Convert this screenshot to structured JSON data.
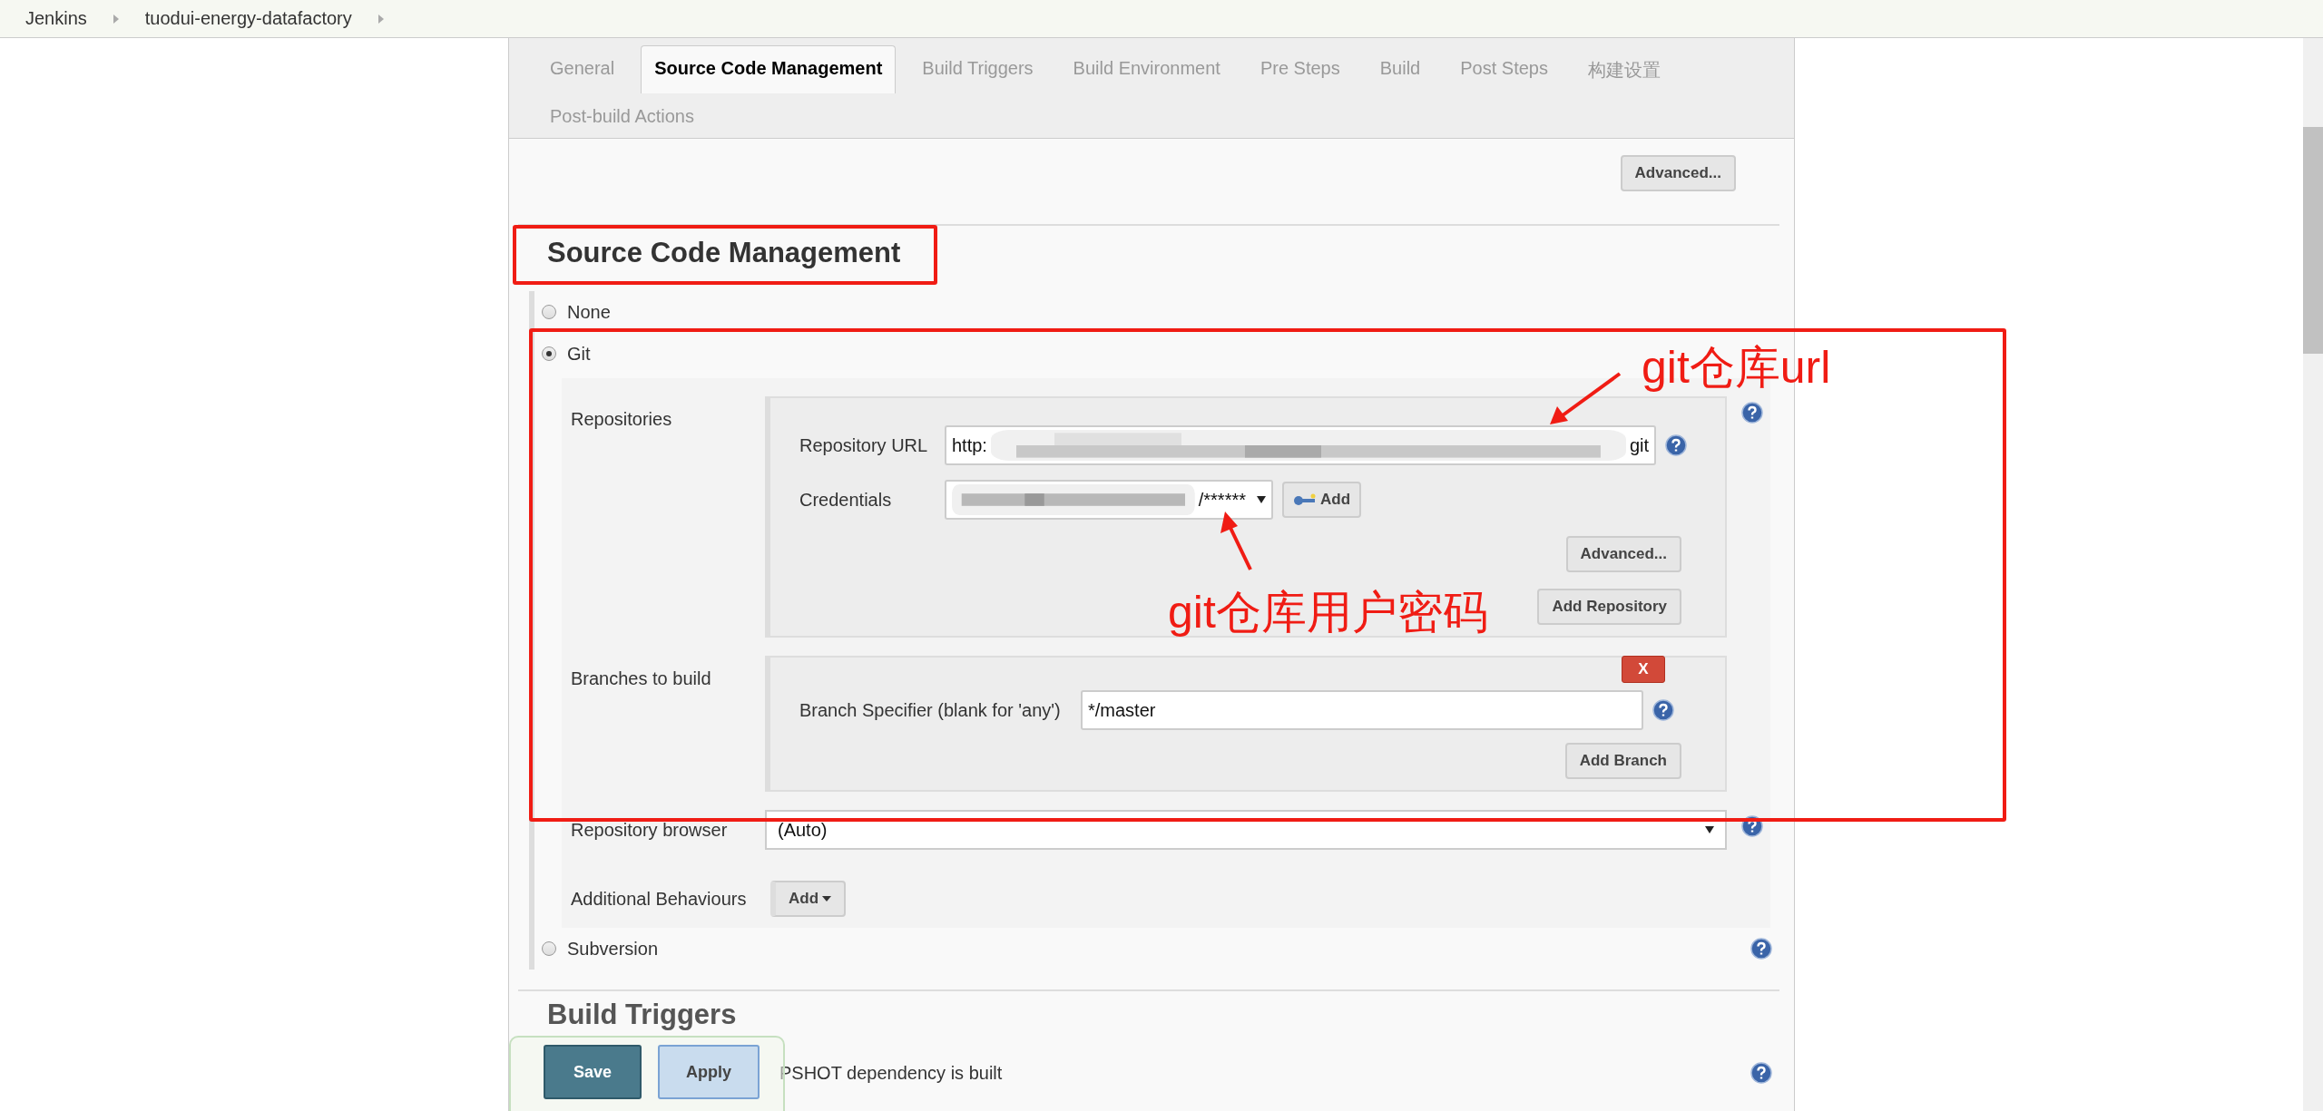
{
  "breadcrumb": [
    "Jenkins",
    "tuodui-energy-datafactory"
  ],
  "tabs": [
    {
      "label": "General",
      "selected": false
    },
    {
      "label": "Source Code Management",
      "selected": true
    },
    {
      "label": "Build Triggers",
      "selected": false
    },
    {
      "label": "Build Environment",
      "selected": false
    },
    {
      "label": "Pre Steps",
      "selected": false
    },
    {
      "label": "Build",
      "selected": false
    },
    {
      "label": "Post Steps",
      "selected": false
    },
    {
      "label": "构建设置",
      "selected": false
    },
    {
      "label": "Post-build Actions",
      "selected": false
    }
  ],
  "advanced_button": "Advanced...",
  "section": {
    "title": "Source Code Management"
  },
  "scm_options": [
    {
      "label": "None",
      "selected": false
    },
    {
      "label": "Git",
      "selected": true
    },
    {
      "label": "Subversion",
      "selected": false
    }
  ],
  "git": {
    "repositories_label": "Repositories",
    "repository_url": {
      "label": "Repository URL",
      "value_start": "http:",
      "value_end": "git"
    },
    "credentials": {
      "label": "Credentials",
      "value": "/******",
      "add_button": "Add"
    },
    "advanced_button": "Advanced...",
    "add_repository_button": "Add Repository",
    "branches_label": "Branches to build",
    "branch_specifier": {
      "label": "Branch Specifier (blank for 'any')",
      "value": "*/master",
      "delete_button": "X"
    },
    "add_branch_button": "Add Branch",
    "repository_browser": {
      "label": "Repository browser",
      "value": "(Auto)"
    },
    "additional_behaviours": {
      "label": "Additional Behaviours",
      "add_button": "Add"
    }
  },
  "next_section": {
    "title": "Build Triggers",
    "option_text": "PSHOT dependency is built"
  },
  "footer_buttons": {
    "save": "Save",
    "apply": "Apply"
  },
  "annotations": [
    {
      "text": "git仓库url"
    },
    {
      "text": "git仓库用户密码"
    }
  ]
}
